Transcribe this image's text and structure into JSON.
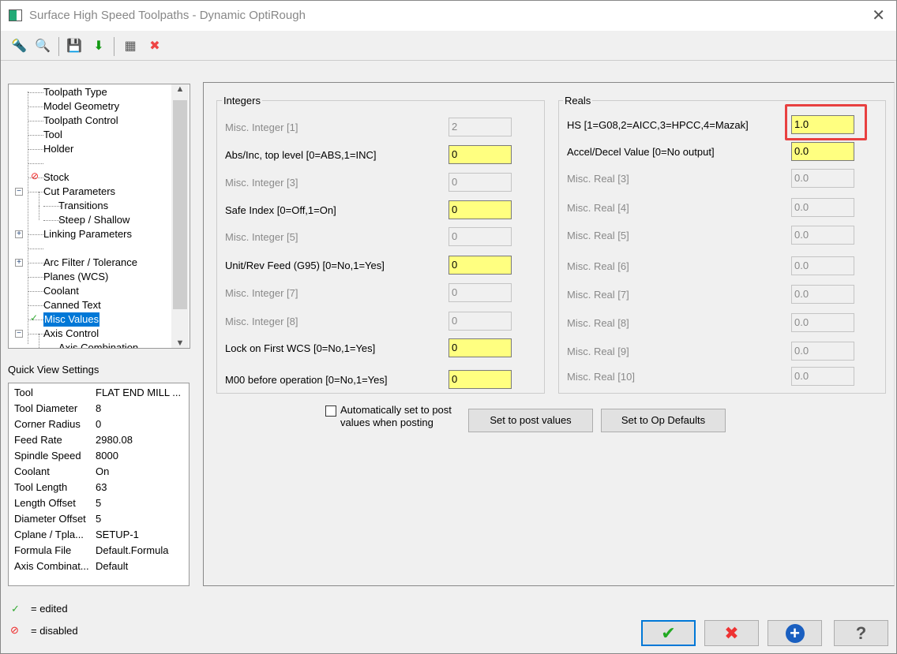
{
  "window": {
    "title": "Surface High Speed Toolpaths - Dynamic OptiRough",
    "close_icon": "close-icon"
  },
  "toolbar": {
    "icons": [
      "tool-icon",
      "view-table-icon",
      "save-icon",
      "load-icon",
      "calculator-icon",
      "close-window-icon"
    ]
  },
  "tree": {
    "items": [
      {
        "label": "Toolpath Type",
        "indent": 0
      },
      {
        "label": "Model Geometry",
        "indent": 0
      },
      {
        "label": "Toolpath Control",
        "indent": 0
      },
      {
        "label": "Tool",
        "indent": 0
      },
      {
        "label": "Holder",
        "indent": 0
      },
      {
        "label": "",
        "indent": 0
      },
      {
        "label": "Stock",
        "indent": 0,
        "status": "disabled"
      },
      {
        "label": "Cut Parameters",
        "indent": 0,
        "expander": "-"
      },
      {
        "label": "Transitions",
        "indent": 1
      },
      {
        "label": "Steep / Shallow",
        "indent": 1
      },
      {
        "label": "Linking Parameters",
        "indent": 0,
        "expander": "+"
      },
      {
        "label": "",
        "indent": 0
      },
      {
        "label": "Arc Filter / Tolerance",
        "indent": 0,
        "expander": "+"
      },
      {
        "label": "Planes (WCS)",
        "indent": 0
      },
      {
        "label": "Coolant",
        "indent": 0
      },
      {
        "label": "Canned Text",
        "indent": 0
      },
      {
        "label": "Misc Values",
        "indent": 0,
        "status": "edited",
        "selected": true
      },
      {
        "label": "Axis Control",
        "indent": 0,
        "expander": "-"
      },
      {
        "label": "Axis Combination",
        "indent": 1
      }
    ]
  },
  "quick_view": {
    "title": "Quick View Settings",
    "rows": [
      [
        "Tool",
        "FLAT END MILL ..."
      ],
      [
        "Tool Diameter",
        "8"
      ],
      [
        "Corner Radius",
        "0"
      ],
      [
        "Feed Rate",
        "2980.08"
      ],
      [
        "Spindle Speed",
        "8000"
      ],
      [
        "Coolant",
        "On"
      ],
      [
        "Tool Length",
        "63"
      ],
      [
        "Length Offset",
        "5"
      ],
      [
        "Diameter Offset",
        "5"
      ],
      [
        "Cplane / Tpla...",
        "SETUP-1"
      ],
      [
        "Formula File",
        "Default.Formula"
      ],
      [
        "Axis Combinat...",
        "Default"
      ]
    ]
  },
  "legend": {
    "edited": "= edited",
    "disabled": "= disabled"
  },
  "integers": {
    "title": "Integers",
    "rows": [
      {
        "label": "Misc. Integer [1]",
        "value": "2",
        "enabled": false
      },
      {
        "label": "Abs/Inc, top level [0=ABS,1=INC]",
        "value": "0",
        "enabled": true
      },
      {
        "label": "Misc. Integer [3]",
        "value": "0",
        "enabled": false
      },
      {
        "label": "Safe Index [0=Off,1=On]",
        "value": "0",
        "enabled": true
      },
      {
        "label": "Misc. Integer [5]",
        "value": "0",
        "enabled": false
      },
      {
        "label": "Unit/Rev Feed (G95) [0=No,1=Yes]",
        "value": "0",
        "enabled": true
      },
      {
        "label": "Misc. Integer [7]",
        "value": "0",
        "enabled": false
      },
      {
        "label": "Misc. Integer [8]",
        "value": "0",
        "enabled": false
      },
      {
        "label": "Lock on First WCS [0=No,1=Yes]",
        "value": "0",
        "enabled": true
      },
      {
        "label": "M00 before operation [0=No,1=Yes]",
        "value": "0",
        "enabled": true
      }
    ]
  },
  "reals": {
    "title": "Reals",
    "rows": [
      {
        "label": "HS [1=G08,2=AICC,3=HPCC,4=Mazak]",
        "value": "1.0",
        "enabled": true,
        "highlighted": true
      },
      {
        "label": "Accel/Decel Value [0=No output]",
        "value": "0.0",
        "enabled": true
      },
      {
        "label": "Misc. Real [3]",
        "value": "0.0",
        "enabled": false
      },
      {
        "label": "Misc. Real [4]",
        "value": "0.0",
        "enabled": false
      },
      {
        "label": "Misc. Real [5]",
        "value": "0.0",
        "enabled": false
      },
      {
        "label": "Misc. Real [6]",
        "value": "0.0",
        "enabled": false
      },
      {
        "label": "Misc. Real [7]",
        "value": "0.0",
        "enabled": false
      },
      {
        "label": "Misc. Real [8]",
        "value": "0.0",
        "enabled": false
      },
      {
        "label": "Misc. Real [9]",
        "value": "0.0",
        "enabled": false
      },
      {
        "label": "Misc. Real [10]",
        "value": "0.0",
        "enabled": false
      }
    ]
  },
  "options": {
    "auto_set_label": "Automatically set to post values when posting",
    "auto_set_checked": false,
    "set_post_label": "Set to post values",
    "set_defaults_label": "Set to Op Defaults"
  },
  "footer": {
    "ok_icon": "checkmark-icon",
    "cancel_icon": "x-icon",
    "add_icon": "plus-icon",
    "help_icon": "question-icon"
  },
  "colors": {
    "input_enabled": "#ffff80",
    "selection": "#0078d7",
    "highlight_box": "#e84040"
  }
}
